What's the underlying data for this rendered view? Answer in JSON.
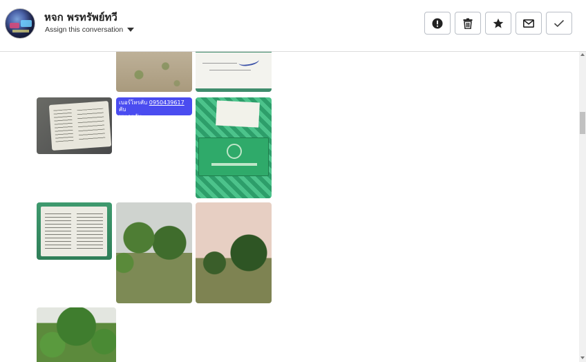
{
  "header": {
    "contact_name": "หจก พรทรัพย์ทวี",
    "assign_label": "Assign this conversation",
    "actions": [
      {
        "name": "report-button",
        "icon": "exclamation-icon"
      },
      {
        "name": "delete-button",
        "icon": "trash-icon"
      },
      {
        "name": "star-button",
        "icon": "star-icon"
      },
      {
        "name": "mail-button",
        "icon": "envelope-icon"
      },
      {
        "name": "mark-done-button",
        "icon": "check-icon"
      }
    ]
  },
  "message": {
    "prefix": "เบอร์โทรคับ",
    "phone": "0950439617",
    "suffix": "คับ",
    "line2": "ผมเลยคับ"
  },
  "colors": {
    "message_bg": "#4a4cf0",
    "border": "#b9bec6"
  }
}
